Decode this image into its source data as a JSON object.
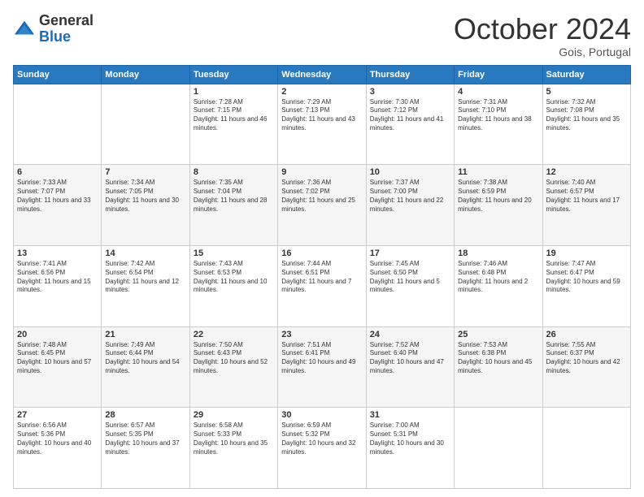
{
  "logo": {
    "general": "General",
    "blue": "Blue"
  },
  "header": {
    "month": "October 2024",
    "location": "Gois, Portugal"
  },
  "weekdays": [
    "Sunday",
    "Monday",
    "Tuesday",
    "Wednesday",
    "Thursday",
    "Friday",
    "Saturday"
  ],
  "weeks": [
    [
      {
        "day": "",
        "sunrise": "",
        "sunset": "",
        "daylight": ""
      },
      {
        "day": "",
        "sunrise": "",
        "sunset": "",
        "daylight": ""
      },
      {
        "day": "1",
        "sunrise": "Sunrise: 7:28 AM",
        "sunset": "Sunset: 7:15 PM",
        "daylight": "Daylight: 11 hours and 46 minutes."
      },
      {
        "day": "2",
        "sunrise": "Sunrise: 7:29 AM",
        "sunset": "Sunset: 7:13 PM",
        "daylight": "Daylight: 11 hours and 43 minutes."
      },
      {
        "day": "3",
        "sunrise": "Sunrise: 7:30 AM",
        "sunset": "Sunset: 7:12 PM",
        "daylight": "Daylight: 11 hours and 41 minutes."
      },
      {
        "day": "4",
        "sunrise": "Sunrise: 7:31 AM",
        "sunset": "Sunset: 7:10 PM",
        "daylight": "Daylight: 11 hours and 38 minutes."
      },
      {
        "day": "5",
        "sunrise": "Sunrise: 7:32 AM",
        "sunset": "Sunset: 7:08 PM",
        "daylight": "Daylight: 11 hours and 35 minutes."
      }
    ],
    [
      {
        "day": "6",
        "sunrise": "Sunrise: 7:33 AM",
        "sunset": "Sunset: 7:07 PM",
        "daylight": "Daylight: 11 hours and 33 minutes."
      },
      {
        "day": "7",
        "sunrise": "Sunrise: 7:34 AM",
        "sunset": "Sunset: 7:05 PM",
        "daylight": "Daylight: 11 hours and 30 minutes."
      },
      {
        "day": "8",
        "sunrise": "Sunrise: 7:35 AM",
        "sunset": "Sunset: 7:04 PM",
        "daylight": "Daylight: 11 hours and 28 minutes."
      },
      {
        "day": "9",
        "sunrise": "Sunrise: 7:36 AM",
        "sunset": "Sunset: 7:02 PM",
        "daylight": "Daylight: 11 hours and 25 minutes."
      },
      {
        "day": "10",
        "sunrise": "Sunrise: 7:37 AM",
        "sunset": "Sunset: 7:00 PM",
        "daylight": "Daylight: 11 hours and 22 minutes."
      },
      {
        "day": "11",
        "sunrise": "Sunrise: 7:38 AM",
        "sunset": "Sunset: 6:59 PM",
        "daylight": "Daylight: 11 hours and 20 minutes."
      },
      {
        "day": "12",
        "sunrise": "Sunrise: 7:40 AM",
        "sunset": "Sunset: 6:57 PM",
        "daylight": "Daylight: 11 hours and 17 minutes."
      }
    ],
    [
      {
        "day": "13",
        "sunrise": "Sunrise: 7:41 AM",
        "sunset": "Sunset: 6:56 PM",
        "daylight": "Daylight: 11 hours and 15 minutes."
      },
      {
        "day": "14",
        "sunrise": "Sunrise: 7:42 AM",
        "sunset": "Sunset: 6:54 PM",
        "daylight": "Daylight: 11 hours and 12 minutes."
      },
      {
        "day": "15",
        "sunrise": "Sunrise: 7:43 AM",
        "sunset": "Sunset: 6:53 PM",
        "daylight": "Daylight: 11 hours and 10 minutes."
      },
      {
        "day": "16",
        "sunrise": "Sunrise: 7:44 AM",
        "sunset": "Sunset: 6:51 PM",
        "daylight": "Daylight: 11 hours and 7 minutes."
      },
      {
        "day": "17",
        "sunrise": "Sunrise: 7:45 AM",
        "sunset": "Sunset: 6:50 PM",
        "daylight": "Daylight: 11 hours and 5 minutes."
      },
      {
        "day": "18",
        "sunrise": "Sunrise: 7:46 AM",
        "sunset": "Sunset: 6:48 PM",
        "daylight": "Daylight: 11 hours and 2 minutes."
      },
      {
        "day": "19",
        "sunrise": "Sunrise: 7:47 AM",
        "sunset": "Sunset: 6:47 PM",
        "daylight": "Daylight: 10 hours and 59 minutes."
      }
    ],
    [
      {
        "day": "20",
        "sunrise": "Sunrise: 7:48 AM",
        "sunset": "Sunset: 6:45 PM",
        "daylight": "Daylight: 10 hours and 57 minutes."
      },
      {
        "day": "21",
        "sunrise": "Sunrise: 7:49 AM",
        "sunset": "Sunset: 6:44 PM",
        "daylight": "Daylight: 10 hours and 54 minutes."
      },
      {
        "day": "22",
        "sunrise": "Sunrise: 7:50 AM",
        "sunset": "Sunset: 6:43 PM",
        "daylight": "Daylight: 10 hours and 52 minutes."
      },
      {
        "day": "23",
        "sunrise": "Sunrise: 7:51 AM",
        "sunset": "Sunset: 6:41 PM",
        "daylight": "Daylight: 10 hours and 49 minutes."
      },
      {
        "day": "24",
        "sunrise": "Sunrise: 7:52 AM",
        "sunset": "Sunset: 6:40 PM",
        "daylight": "Daylight: 10 hours and 47 minutes."
      },
      {
        "day": "25",
        "sunrise": "Sunrise: 7:53 AM",
        "sunset": "Sunset: 6:38 PM",
        "daylight": "Daylight: 10 hours and 45 minutes."
      },
      {
        "day": "26",
        "sunrise": "Sunrise: 7:55 AM",
        "sunset": "Sunset: 6:37 PM",
        "daylight": "Daylight: 10 hours and 42 minutes."
      }
    ],
    [
      {
        "day": "27",
        "sunrise": "Sunrise: 6:56 AM",
        "sunset": "Sunset: 5:36 PM",
        "daylight": "Daylight: 10 hours and 40 minutes."
      },
      {
        "day": "28",
        "sunrise": "Sunrise: 6:57 AM",
        "sunset": "Sunset: 5:35 PM",
        "daylight": "Daylight: 10 hours and 37 minutes."
      },
      {
        "day": "29",
        "sunrise": "Sunrise: 6:58 AM",
        "sunset": "Sunset: 5:33 PM",
        "daylight": "Daylight: 10 hours and 35 minutes."
      },
      {
        "day": "30",
        "sunrise": "Sunrise: 6:59 AM",
        "sunset": "Sunset: 5:32 PM",
        "daylight": "Daylight: 10 hours and 32 minutes."
      },
      {
        "day": "31",
        "sunrise": "Sunrise: 7:00 AM",
        "sunset": "Sunset: 5:31 PM",
        "daylight": "Daylight: 10 hours and 30 minutes."
      },
      {
        "day": "",
        "sunrise": "",
        "sunset": "",
        "daylight": ""
      },
      {
        "day": "",
        "sunrise": "",
        "sunset": "",
        "daylight": ""
      }
    ]
  ]
}
